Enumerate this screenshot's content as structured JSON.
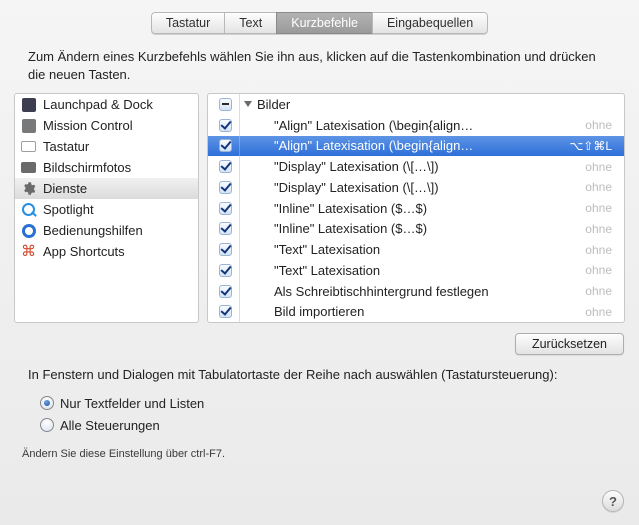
{
  "tabs": {
    "items": [
      {
        "label": "Tastatur",
        "selected": false
      },
      {
        "label": "Text",
        "selected": false
      },
      {
        "label": "Kurzbefehle",
        "selected": true
      },
      {
        "label": "Eingabequellen",
        "selected": false
      }
    ]
  },
  "instruction": "Zum Ändern eines Kurzbefehls wählen Sie ihn aus, klicken auf die Tastenkombination und drücken die neuen Tasten.",
  "sidebar": {
    "items": [
      {
        "label": "Launchpad & Dock",
        "icon": "launchpad-icon",
        "selected": false
      },
      {
        "label": "Mission Control",
        "icon": "mission-control-icon",
        "selected": false
      },
      {
        "label": "Tastatur",
        "icon": "keyboard-icon",
        "selected": false
      },
      {
        "label": "Bildschirmfotos",
        "icon": "camera-icon",
        "selected": false
      },
      {
        "label": "Dienste",
        "icon": "gear-icon",
        "selected": true
      },
      {
        "label": "Spotlight",
        "icon": "magnifier-icon",
        "selected": false
      },
      {
        "label": "Bedienungshilfen",
        "icon": "accessibility-icon",
        "selected": false
      },
      {
        "label": "App Shortcuts",
        "icon": "app-shortcuts-icon",
        "selected": false
      }
    ]
  },
  "detail": {
    "group_label": "Bilder",
    "items": [
      {
        "label": "\"Align\" Latexisation (\\begin{align…",
        "shortcut": "ohne",
        "selected": false
      },
      {
        "label": "\"Align\" Latexisation (\\begin{align…",
        "shortcut": "⌥⇧⌘L",
        "selected": true
      },
      {
        "label": "\"Display\" Latexisation (\\[…\\])",
        "shortcut": "ohne",
        "selected": false
      },
      {
        "label": "\"Display\" Latexisation (\\[…\\])",
        "shortcut": "ohne",
        "selected": false
      },
      {
        "label": "\"Inline\" Latexisation ($…$)",
        "shortcut": "ohne",
        "selected": false
      },
      {
        "label": "\"Inline\" Latexisation ($…$)",
        "shortcut": "ohne",
        "selected": false
      },
      {
        "label": "\"Text\" Latexisation",
        "shortcut": "ohne",
        "selected": false
      },
      {
        "label": "\"Text\" Latexisation",
        "shortcut": "ohne",
        "selected": false
      },
      {
        "label": "Als Schreibtischhintergrund festlegen",
        "shortcut": "ohne",
        "selected": false
      },
      {
        "label": "Bild importieren",
        "shortcut": "ohne",
        "selected": false
      }
    ]
  },
  "reset_label": "Zurücksetzen",
  "kb_instruction": "In Fenstern und Dialogen mit Tabulatortaste der Reihe nach auswählen (Tastatursteuerung):",
  "radios": {
    "opt1": "Nur Textfelder und Listen",
    "opt2": "Alle Steuerungen"
  },
  "hint": "Ändern Sie diese Einstellung über ctrl-F7.",
  "help_glyph": "?"
}
